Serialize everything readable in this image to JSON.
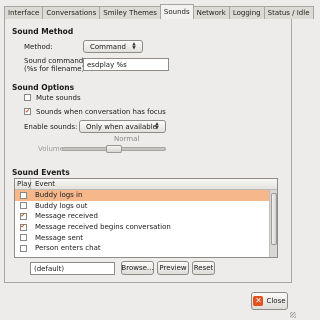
{
  "tabs": [
    {
      "label": "Interface"
    },
    {
      "label": "Conversations"
    },
    {
      "label": "Smiley Themes"
    },
    {
      "label": "Sounds",
      "active": true
    },
    {
      "label": "Network"
    },
    {
      "label": "Logging"
    },
    {
      "label": "Status / Idle"
    }
  ],
  "sound_method": {
    "title": "Sound Method",
    "method_label": "Method:",
    "method_value": "Command",
    "command_label_1": "Sound command:",
    "command_label_2": "(%s for filename)",
    "command_value": "esdplay %s"
  },
  "sound_options": {
    "title": "Sound Options",
    "mute_label": "Mute sounds",
    "mute_checked": false,
    "focus_label": "Sounds when conversation has focus",
    "focus_checked": true,
    "enable_label": "Enable sounds:",
    "enable_value": "Only when available",
    "volume_label": "Volume:",
    "volume_value_text": "Normal"
  },
  "sound_events": {
    "title": "Sound Events",
    "col_play": "Play",
    "col_event": "Event",
    "rows": [
      {
        "event": "Buddy logs in",
        "checked": false,
        "selected": true
      },
      {
        "event": "Buddy logs out",
        "checked": false,
        "selected": false
      },
      {
        "event": "Message received",
        "checked": true,
        "selected": false
      },
      {
        "event": "Message received begins conversation",
        "checked": true,
        "selected": false
      },
      {
        "event": "Message sent",
        "checked": false,
        "selected": false
      },
      {
        "event": "Person enters chat",
        "checked": false,
        "selected": false
      }
    ],
    "file_value": "(default)",
    "browse_label": "Browse...",
    "preview_label": "Preview",
    "reset_label": "Reset"
  },
  "footer": {
    "close_label": "Close"
  },
  "colors": {
    "selection": "#f6b88b",
    "check_mark": "#c2571a",
    "close_icon": "#e2521d"
  },
  "icons": {
    "checkmark": "checkmark-icon",
    "close": "close-icon",
    "combo_arrows": "updown-arrows-icon"
  }
}
